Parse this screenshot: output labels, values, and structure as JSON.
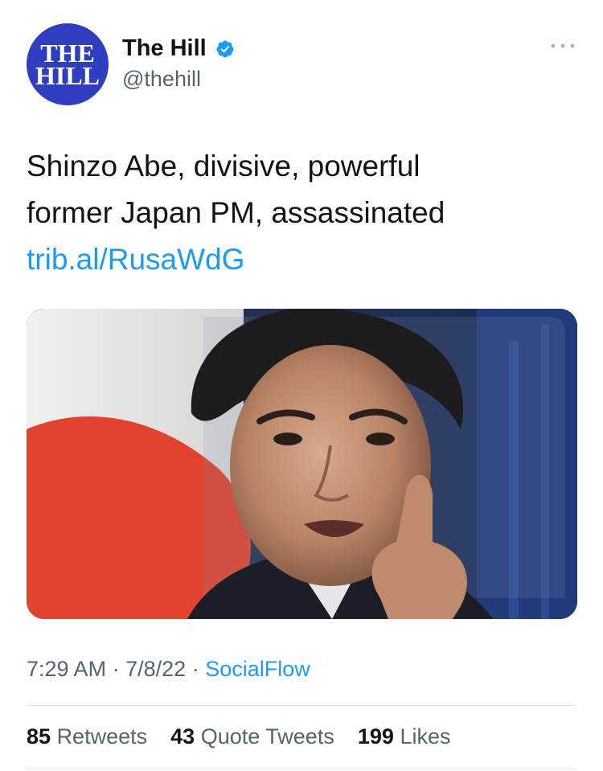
{
  "account": {
    "avatar_line1": "THE",
    "avatar_line2": "HILL",
    "display_name": "The Hill",
    "handle": "@thehill",
    "verified": true,
    "avatar_color": "#2f3dc0"
  },
  "tweet": {
    "text_line1": "Shinzo Abe, divisive, powerful",
    "text_line2": "former Japan PM, assassinated",
    "link": "trib.al/RusaWdG",
    "time": "7:29 AM",
    "date": "7/8/22",
    "separator": "·",
    "source": "SocialFlow"
  },
  "stats": {
    "retweets_count": "85",
    "retweets_label": "Retweets",
    "quotes_count": "43",
    "quotes_label": "Quote Tweets",
    "likes_count": "199",
    "likes_label": "Likes"
  },
  "icons": {
    "verified": "verified-badge-icon",
    "more": "more-options-icon"
  },
  "colors": {
    "link": "#1d9bf0",
    "secondary_text": "#536471",
    "primary_text": "#0f1419",
    "flag_red": "#e1432e"
  }
}
